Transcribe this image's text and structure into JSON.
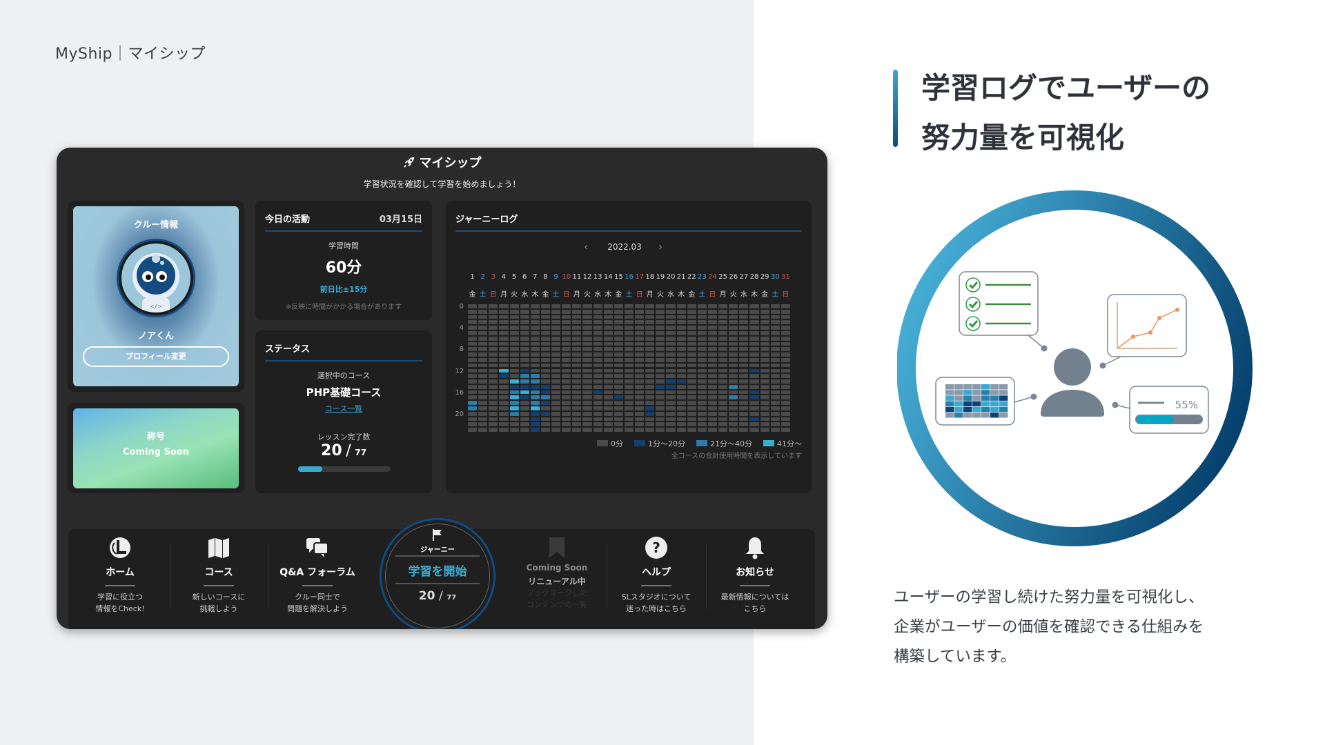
{
  "brand": "MyShip｜マイシップ",
  "app": {
    "title": "マイシップ",
    "subtitle": "学習状況を確認して学習を始めましょう！",
    "crew": {
      "heading": "クルー情報",
      "name": "ノアくん",
      "profile_button": "プロフィール変更"
    },
    "rank": {
      "heading": "称号",
      "value": "Coming Soon"
    },
    "today": {
      "heading": "今日の活動",
      "date": "03月15日",
      "time_label": "学習時間",
      "time_value": "60分",
      "diff": "前日比±15分",
      "note": "※反映に時間がかかる場合があります"
    },
    "status": {
      "heading": "ステータス",
      "course_label": "選択中のコース",
      "course": "PHP基礎コース",
      "course_link": "コース一覧",
      "lessons_label": "レッスン完了数",
      "lessons_done": "20",
      "lessons_sep": "/",
      "lessons_total": "77",
      "progress": 0.26
    },
    "journey_log": {
      "heading": "ジャーニーログ",
      "month": "2022.03",
      "days": [
        "1",
        "2",
        "3",
        "4",
        "5",
        "6",
        "7",
        "8",
        "9",
        "10",
        "11",
        "12",
        "13",
        "14",
        "15",
        "16",
        "17",
        "18",
        "19",
        "20",
        "21",
        "22",
        "23",
        "24",
        "25",
        "26",
        "27",
        "28",
        "29",
        "30",
        "31"
      ],
      "weekdays": [
        "金",
        "土",
        "日",
        "月",
        "火",
        "水",
        "木",
        "金",
        "土",
        "日",
        "月",
        "火",
        "水",
        "木",
        "金",
        "土",
        "日",
        "月",
        "火",
        "水",
        "木",
        "金",
        "土",
        "日",
        "月",
        "火",
        "水",
        "木",
        "金",
        "土",
        "日"
      ],
      "hour_labels": [
        "0",
        "4",
        "8",
        "12",
        "16",
        "20"
      ],
      "cells": [
        [
          1,
          18,
          2
        ],
        [
          1,
          19,
          2
        ],
        [
          4,
          12,
          3
        ],
        [
          4,
          13,
          1
        ],
        [
          5,
          14,
          3
        ],
        [
          5,
          15,
          1
        ],
        [
          5,
          16,
          2
        ],
        [
          5,
          17,
          3
        ],
        [
          5,
          18,
          2
        ],
        [
          5,
          19,
          3
        ],
        [
          5,
          20,
          2
        ],
        [
          6,
          12,
          1
        ],
        [
          6,
          13,
          2
        ],
        [
          6,
          14,
          2
        ],
        [
          6,
          15,
          1
        ],
        [
          6,
          16,
          3
        ],
        [
          6,
          17,
          1
        ],
        [
          7,
          13,
          2
        ],
        [
          7,
          14,
          2
        ],
        [
          7,
          15,
          1
        ],
        [
          7,
          16,
          2
        ],
        [
          7,
          17,
          2
        ],
        [
          7,
          18,
          2
        ],
        [
          7,
          19,
          3
        ],
        [
          7,
          20,
          1
        ],
        [
          7,
          21,
          1
        ],
        [
          7,
          22,
          1
        ],
        [
          7,
          23,
          1
        ],
        [
          8,
          15,
          1
        ],
        [
          8,
          16,
          1
        ],
        [
          8,
          17,
          2
        ],
        [
          8,
          18,
          1
        ],
        [
          8,
          20,
          1
        ],
        [
          13,
          16,
          1
        ],
        [
          15,
          17,
          1
        ],
        [
          18,
          19,
          1
        ],
        [
          18,
          20,
          1
        ],
        [
          19,
          15,
          1
        ],
        [
          20,
          14,
          1
        ],
        [
          20,
          15,
          1
        ],
        [
          21,
          14,
          1
        ],
        [
          26,
          15,
          2
        ],
        [
          26,
          17,
          2
        ],
        [
          28,
          12,
          1
        ],
        [
          28,
          16,
          1
        ],
        [
          28,
          17,
          1
        ],
        [
          28,
          21,
          1
        ]
      ],
      "legend": [
        "0分",
        "1分〜20分",
        "21分〜40分",
        "41分〜"
      ],
      "note": "全コースの合計使用時間を表示しています",
      "colors": {
        "empty": "#4a4a4a",
        "level1": "#15406e",
        "level2": "#2e7ca8",
        "level3": "#3ab0d0",
        "saturday": "#4aa3e8",
        "sunday": "#d9534f"
      }
    },
    "nav": {
      "home": {
        "label": "ホーム",
        "desc": "学習に役立つ\n情報をCheck!"
      },
      "course": {
        "label": "コース",
        "desc": "新しいコースに\n挑戦しよう"
      },
      "qa": {
        "label": "Q&A フォーラム",
        "desc": "クルー同士で\n問題を解決しよう"
      },
      "journey": {
        "label": "ジャーニー",
        "cta": "学習を開始",
        "done": "20",
        "sep": "/",
        "total": "77"
      },
      "bookmark": {
        "badge": "Coming Soon",
        "label": "リニューアル中",
        "desc": "ブックマークした\nコンテンツの一覧"
      },
      "help": {
        "label": "ヘルプ",
        "desc": "SLスタジオについて\n迷った時はこちら"
      },
      "news": {
        "label": "お知らせ",
        "desc": "最新情報については\nこちら"
      }
    }
  },
  "right": {
    "heading_line1": "学習ログでユーザーの",
    "heading_line2": "努力量を可視化",
    "illustration_percent": "55%",
    "body_lines": [
      "ユーザーの学習し続けた努力量を可視化し、",
      "企業がユーザーの価値を確認できる仕組みを",
      "構築しています。"
    ],
    "accent": "#1a6a9e"
  }
}
